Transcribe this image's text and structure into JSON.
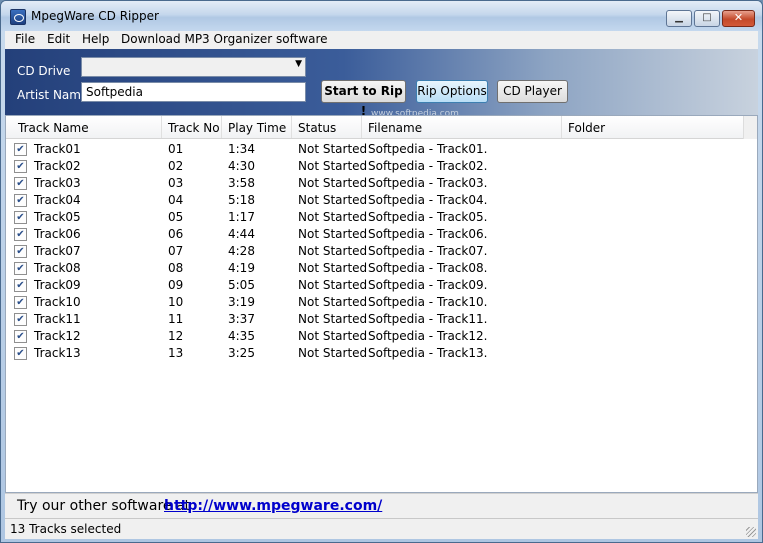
{
  "window": {
    "title": "MpegWare CD Ripper",
    "minimize_glyph": "▁",
    "maximize_glyph": "□",
    "close_glyph": "✕"
  },
  "menu": {
    "file": "File",
    "edit": "Edit",
    "help": "Help",
    "download": "Download MP3 Organizer software"
  },
  "controls": {
    "cd_drive_label": "CD Drive",
    "cd_drive_value": "",
    "dropdown_arrow": "▼",
    "artist_label": "Artist Name",
    "artist_value": "Softpedia",
    "start_button": "Start to Rip !",
    "options_button": "Rip Options",
    "player_button": "CD Player",
    "watermark": "www.softpedia.com"
  },
  "table": {
    "columns": [
      "Track Name",
      "Track No",
      "Play Time",
      "Status",
      "Filename",
      "Folder"
    ],
    "check_glyph": "✔",
    "rows": [
      {
        "name": "Track01",
        "no": "01",
        "time": "1:34",
        "status": "Not Started",
        "filename": "Softpedia - Track01.",
        "folder": ""
      },
      {
        "name": "Track02",
        "no": "02",
        "time": "4:30",
        "status": "Not Started",
        "filename": "Softpedia - Track02.",
        "folder": ""
      },
      {
        "name": "Track03",
        "no": "03",
        "time": "3:58",
        "status": "Not Started",
        "filename": "Softpedia - Track03.",
        "folder": ""
      },
      {
        "name": "Track04",
        "no": "04",
        "time": "5:18",
        "status": "Not Started",
        "filename": "Softpedia - Track04.",
        "folder": ""
      },
      {
        "name": "Track05",
        "no": "05",
        "time": "1:17",
        "status": "Not Started",
        "filename": "Softpedia - Track05.",
        "folder": ""
      },
      {
        "name": "Track06",
        "no": "06",
        "time": "4:44",
        "status": "Not Started",
        "filename": "Softpedia - Track06.",
        "folder": ""
      },
      {
        "name": "Track07",
        "no": "07",
        "time": "4:28",
        "status": "Not Started",
        "filename": "Softpedia - Track07.",
        "folder": ""
      },
      {
        "name": "Track08",
        "no": "08",
        "time": "4:19",
        "status": "Not Started",
        "filename": "Softpedia - Track08.",
        "folder": ""
      },
      {
        "name": "Track09",
        "no": "09",
        "time": "5:05",
        "status": "Not Started",
        "filename": "Softpedia - Track09.",
        "folder": ""
      },
      {
        "name": "Track10",
        "no": "10",
        "time": "3:19",
        "status": "Not Started",
        "filename": "Softpedia - Track10.",
        "folder": ""
      },
      {
        "name": "Track11",
        "no": "11",
        "time": "3:37",
        "status": "Not Started",
        "filename": "Softpedia - Track11.",
        "folder": ""
      },
      {
        "name": "Track12",
        "no": "12",
        "time": "4:35",
        "status": "Not Started",
        "filename": "Softpedia - Track12.",
        "folder": ""
      },
      {
        "name": "Track13",
        "no": "13",
        "time": "3:25",
        "status": "Not Started",
        "filename": "Softpedia - Track13.",
        "folder": ""
      }
    ]
  },
  "footer": {
    "ad_text": "Try our other software at",
    "ad_link": "http://www.mpegware.com/",
    "status": "13 Tracks selected"
  }
}
